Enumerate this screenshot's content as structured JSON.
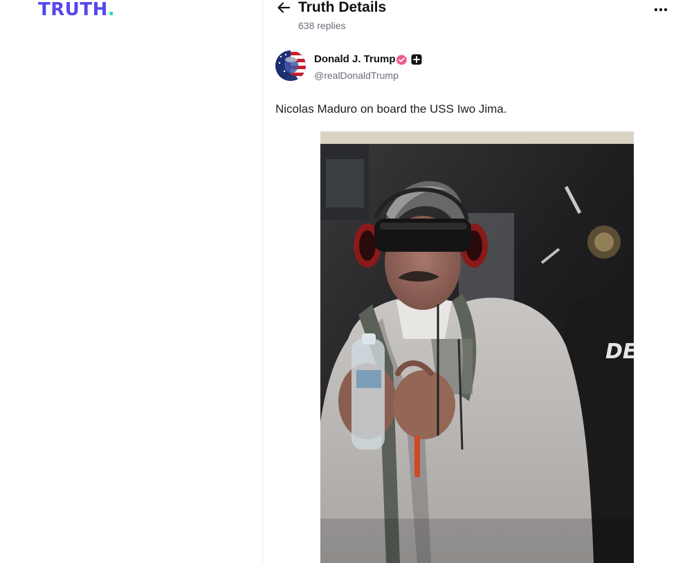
{
  "sidebar": {
    "logo_text": "TRUTH",
    "logo_dot": ".",
    "brand_color": "#5448ee",
    "accent_color": "#17e3a4"
  },
  "header": {
    "back_icon": "arrow-left-icon",
    "title": "Truth Details",
    "replies": "638 replies",
    "more_icon": "more-horizontal-icon"
  },
  "post": {
    "author_name": "Donald J. Trump",
    "author_handle": "@realDonaldTrump",
    "verified_icon": "verified-badge-icon",
    "verified_color": "#f0568c",
    "plus_icon": "plus-badge-icon",
    "text": "Nicolas Maduro on board the USS Iwo Jima.",
    "media": {
      "type": "photo",
      "jacket_lettering": "DEA"
    }
  }
}
